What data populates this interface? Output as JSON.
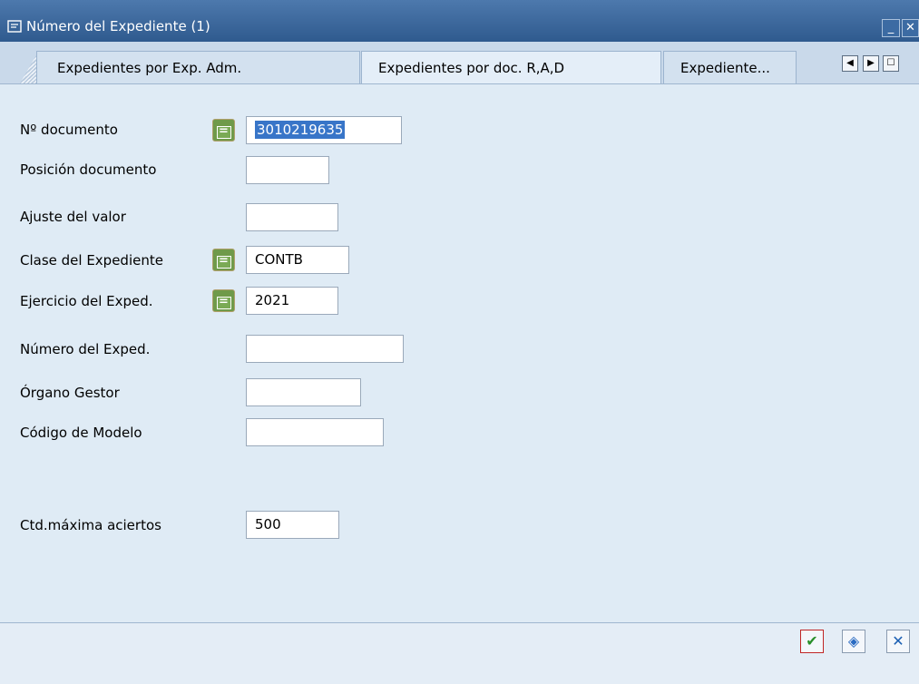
{
  "window": {
    "title": "Número del Expediente (1)",
    "minimize_label": "_",
    "close_label": "✕"
  },
  "tabs": [
    {
      "label": "Expedientes por Exp. Adm."
    },
    {
      "label": "Expedientes por doc. R,A,D"
    },
    {
      "label": "Expediente..."
    }
  ],
  "tab_nav": {
    "left": "◀",
    "right": "▶",
    "list": "☐"
  },
  "form": {
    "doc_number": {
      "label": "Nº documento",
      "value": "3010219635"
    },
    "doc_position": {
      "label": "Posición documento",
      "value": ""
    },
    "value_adjust": {
      "label": "Ajuste del valor",
      "value": ""
    },
    "exp_class": {
      "label": "Clase del Expediente",
      "value": "CONTB"
    },
    "exp_year": {
      "label": "Ejercicio del Exped.",
      "value": "2021"
    },
    "exp_number": {
      "label": "Número del Exped.",
      "value": ""
    },
    "managing_body": {
      "label": "Órgano Gestor",
      "value": ""
    },
    "model_code": {
      "label": "Código de Modelo",
      "value": ""
    },
    "max_hits": {
      "label": "Ctd.máxima aciertos",
      "value": "500"
    },
    "equals_symbol": "="
  },
  "actions": {
    "confirm": "✔",
    "multi": "◈",
    "cancel": "✕"
  },
  "colors": {
    "titlebar": "#2f5a8e",
    "background": "#dfebf5",
    "selection": "#3875c8",
    "equals_button": "#6f9a4a"
  }
}
